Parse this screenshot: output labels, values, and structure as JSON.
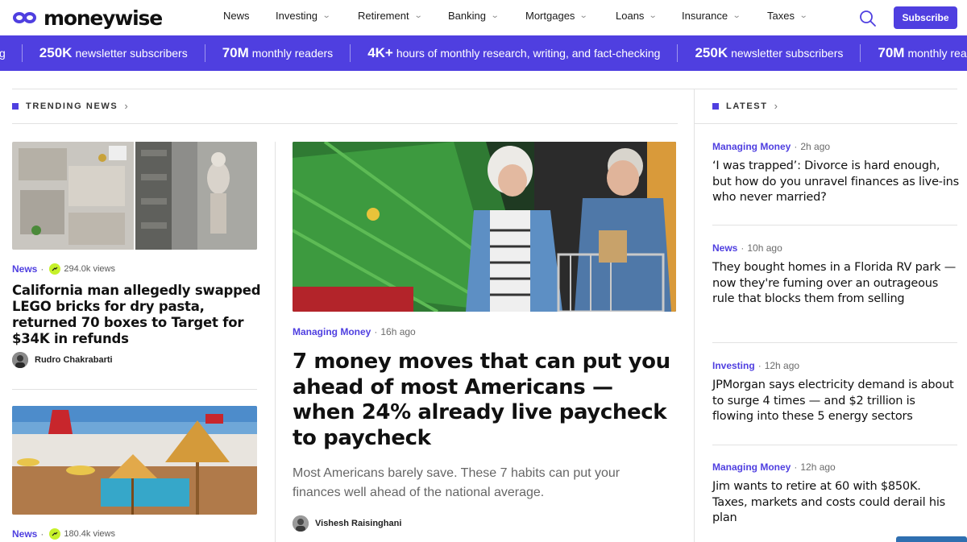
{
  "brand": {
    "name": "moneywise"
  },
  "nav": {
    "items": [
      {
        "label": "News",
        "dropdown": false
      },
      {
        "label": "Investing",
        "dropdown": true
      },
      {
        "label": "Retirement",
        "dropdown": true
      },
      {
        "label": "Banking",
        "dropdown": true
      },
      {
        "label": "Mortgages",
        "dropdown": true
      },
      {
        "label": "Loans",
        "dropdown": true
      },
      {
        "label": "Insurance",
        "dropdown": true
      },
      {
        "label": "Taxes",
        "dropdown": true
      }
    ],
    "subscribe_label": "Subscribe"
  },
  "banner": {
    "lead_fragment": "g",
    "stats": [
      {
        "value": "250K",
        "label": "newsletter subscribers"
      },
      {
        "value": "70M",
        "label": "monthly readers"
      },
      {
        "value": "4K+",
        "label": "hours of monthly research, writing, and fact-checking"
      },
      {
        "value": "250K",
        "label": "newsletter subscribers"
      },
      {
        "value": "70M",
        "label": "monthly readers"
      }
    ]
  },
  "trending": {
    "heading": "TRENDING NEWS",
    "cards": [
      {
        "category": "News",
        "views": "294.0k views",
        "title": "California man allegedly swapped LEGO bricks for dry pasta, returned 70 boxes to Target for $34K in refunds",
        "author": "Rudro Chakrabarti"
      },
      {
        "category": "News",
        "views": "180.4k views"
      }
    ]
  },
  "feature": {
    "category": "Managing Money",
    "time": "16h ago",
    "title": "7 money moves that can put you ahead of most Americans — when 24% already live paycheck to paycheck",
    "description": "Most Americans barely save. These 7 habits can put your finances well ahead of the national average.",
    "author": "Vishesh Raisinghani"
  },
  "latest": {
    "heading": "LATEST",
    "items": [
      {
        "category": "Managing Money",
        "time": "2h ago",
        "title": "‘I was trapped’: Divorce is hard enough, but how do you unravel finances as live-ins who never married?"
      },
      {
        "category": "News",
        "time": "10h ago",
        "title": "They bought homes in a Florida RV park — now they're fuming over an outrageous rule that blocks them from selling"
      },
      {
        "category": "Investing",
        "time": "12h ago",
        "title": "JPMorgan says electricity demand is about to surge 4 times — and $2 trillion is flowing into these 5 energy sectors"
      },
      {
        "category": "Managing Money",
        "time": "12h ago",
        "title": "Jim wants to retire at 60 with $850K. Taxes, markets and costs could derail his plan"
      }
    ]
  },
  "colors": {
    "brand": "#4f3fe0",
    "views_badge": "#c6f12a"
  }
}
